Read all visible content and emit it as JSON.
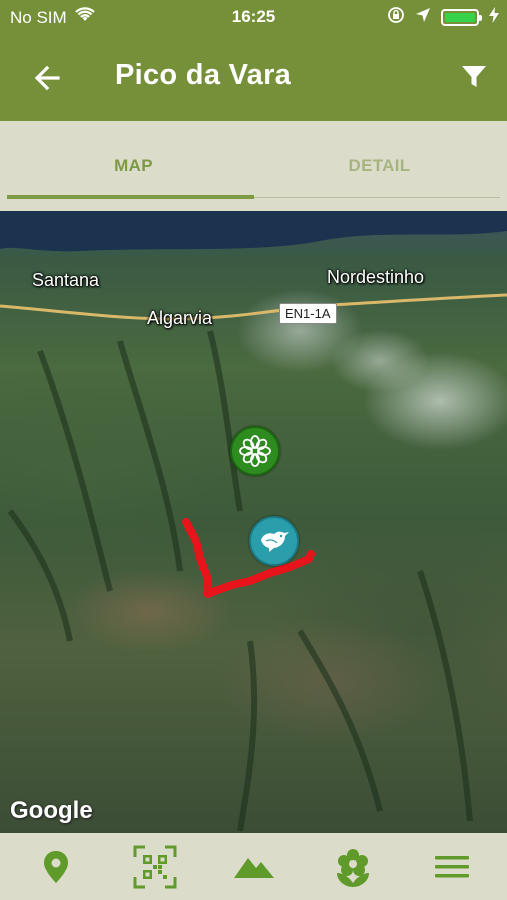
{
  "status_bar": {
    "carrier": "No SIM",
    "time": "16:25",
    "battery_level": 1.0,
    "icons": [
      "wifi-icon",
      "lock-rotation-icon",
      "location-arrow-icon",
      "battery-icon",
      "charging-icon"
    ]
  },
  "header": {
    "title": "Pico da Vara",
    "back_icon": "arrow-left-icon",
    "filter_icon": "filter-icon"
  },
  "tabs": [
    {
      "label": "MAP",
      "active": true
    },
    {
      "label": "DETAIL",
      "active": false
    }
  ],
  "map": {
    "labels": {
      "santana": "Santana",
      "nordestinho": "Nordestinho",
      "algarvia": "Algarvia",
      "road": "EN1-1A"
    },
    "markers": [
      {
        "name": "flower-marker",
        "icon": "flower-icon",
        "color": "#2e8b1f"
      },
      {
        "name": "bird-marker",
        "icon": "bird-icon",
        "color": "#2a9eaa"
      }
    ],
    "route_color": "#e8141b",
    "attribution": "Google"
  },
  "bottom_nav": [
    {
      "name": "location-pin-icon"
    },
    {
      "name": "qr-code-icon"
    },
    {
      "name": "mountain-icon"
    },
    {
      "name": "flower-icon"
    },
    {
      "name": "menu-icon"
    }
  ],
  "colors": {
    "primary": "#76903a",
    "tab_active": "#7e9a44",
    "tab_inactive": "#a7b47f",
    "surface": "#dcdccb",
    "nav_icon": "#5f9a2a"
  }
}
